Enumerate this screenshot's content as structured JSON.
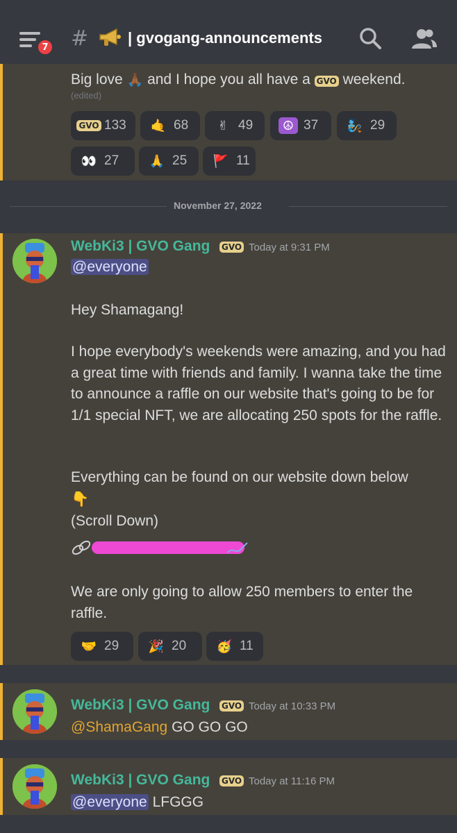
{
  "header": {
    "badge_count": "7",
    "hash": "#",
    "channel_name": "| gvogang-announcements",
    "icons": [
      "hamburger-menu-icon",
      "megaphone-icon",
      "search-icon",
      "members-icon"
    ]
  },
  "top_message": {
    "text_before": "Big love",
    "text_middle": "and I hope you all have a",
    "text_after": "weekend.",
    "edited": "(edited)",
    "reactions": [
      {
        "emoji": "GVO",
        "count": "133"
      },
      {
        "emoji": "shama-hand",
        "count": "68"
      },
      {
        "emoji": "peace-hand",
        "count": "49"
      },
      {
        "emoji": "☮",
        "count": "37"
      },
      {
        "emoji": "character",
        "count": "29"
      },
      {
        "emoji": "👀",
        "count": "27"
      },
      {
        "emoji": "bow-hands",
        "count": "25"
      },
      {
        "emoji": "flag-figure",
        "count": "11"
      }
    ]
  },
  "date_divider": "November 27, 2022",
  "messages": [
    {
      "author": "WebKi3 | GVO Gang",
      "tag": "GVO",
      "time": "Today at 9:31 PM",
      "mention": "@everyone",
      "greeting": "Hey Shamagang!",
      "paragraph1": "I hope everybody's weekends were amazing, and you had a great time with friends and family. I wanna take the time to announce a raffle on our website that's going to be for 1/1 special NFT, we are allocating 250 spots for the raffle.",
      "paragraph2_line1": "Everything can be found on our website down below",
      "pointing_emoji": "👇",
      "scroll_note": "(Scroll Down)",
      "paragraph3": "We are only going to allow 250 members to enter the raffle.",
      "reactions": [
        {
          "emoji": "🤝",
          "count": "29"
        },
        {
          "emoji": "🎉",
          "count": "20"
        },
        {
          "emoji": "🥳",
          "count": "11"
        }
      ]
    },
    {
      "author": "WebKi3 | GVO Gang",
      "tag": "GVO",
      "time": "Today at 10:33 PM",
      "mention": "@ShamaGang",
      "text": "GO GO GO"
    },
    {
      "author": "WebKi3 | GVO Gang",
      "tag": "GVO",
      "time": "Today at 11:16 PM",
      "mention": "@everyone",
      "text": "LFGGG"
    }
  ],
  "colors": {
    "background": "#36393f",
    "highlight": "#45423b",
    "highlight_border": "#f0b232",
    "author": "#45b89a",
    "mention_bg": "#4c4f86"
  }
}
